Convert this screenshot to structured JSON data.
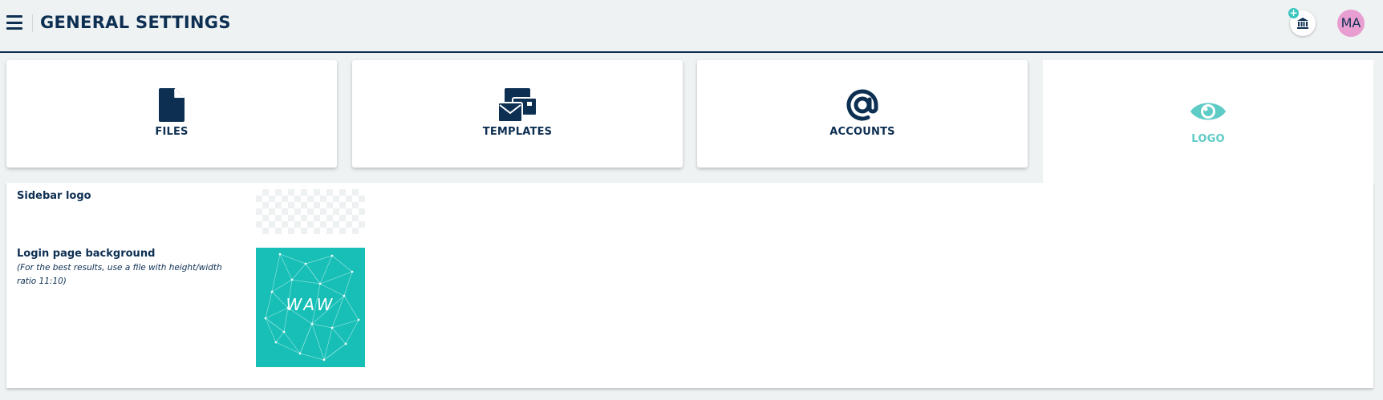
{
  "header": {
    "title": "GENERAL SETTINGS",
    "menu_icon": "hamburger-icon",
    "bank_icon": "bank-icon",
    "add_badge": "+",
    "avatar_initials": "MA"
  },
  "tabs": [
    {
      "label": "FILES",
      "icon": "file-icon",
      "active": false
    },
    {
      "label": "TEMPLATES",
      "icon": "envelopes-icon",
      "active": false
    },
    {
      "label": "ACCOUNTS",
      "icon": "at-icon",
      "active": false
    },
    {
      "label": "LOGO",
      "icon": "eye-icon",
      "active": true
    }
  ],
  "logo_settings": {
    "sidebar_logo_label": "Sidebar logo",
    "login_bg_label": "Login page background",
    "login_bg_note": "(For the best results, use a file with height/width ratio 11:10)",
    "login_bg_image_text": "WAW"
  },
  "colors": {
    "primary": "#0d2f52",
    "accent": "#5ecbc6",
    "avatar": "#e99ed1",
    "login_bg": "#17bfb7"
  }
}
